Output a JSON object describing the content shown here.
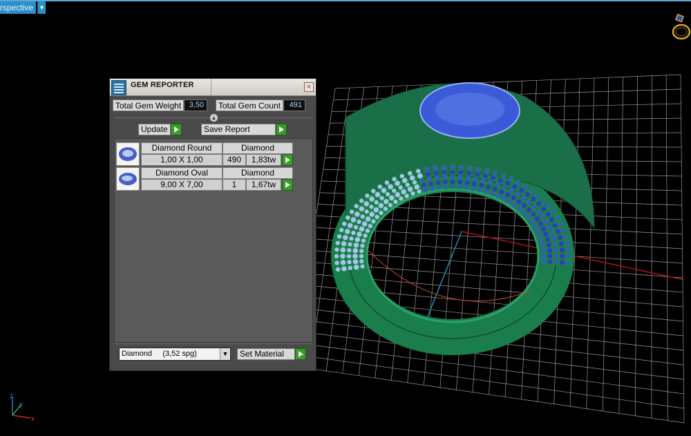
{
  "viewport": {
    "tab_label": "rspective",
    "tab_dropdown_icon": "chevron-down-icon",
    "axis_labels": {
      "z": "z",
      "y": "y",
      "x": "x"
    }
  },
  "gem_reporter": {
    "title": "GEM REPORTER",
    "close_icon": "close-icon",
    "total_weight_label": "Total Gem Weight",
    "total_weight_value": "3,50",
    "total_count_label": "Total Gem Count",
    "total_count_value": "491",
    "update_label": "Update",
    "save_report_label": "Save Report",
    "rows": [
      {
        "name": "Diamond Round",
        "material": "Diamond",
        "size": "1,00 X 1,00",
        "count": "490",
        "weight": "1,83tw"
      },
      {
        "name": "Diamond Oval",
        "material": "Diamond",
        "size": "9,00 X 7,00",
        "count": "1",
        "weight": "1,67tw"
      }
    ],
    "material_select": "Diamond     (3,52 spg)",
    "set_material_label": "Set Material"
  },
  "colors": {
    "accent": "#2b8fc8",
    "play_green": "#3a9a2c",
    "ring_green": "#1f8a55",
    "gem_blue": "#2a3fb8",
    "gem_light": "#9fb8ee"
  }
}
